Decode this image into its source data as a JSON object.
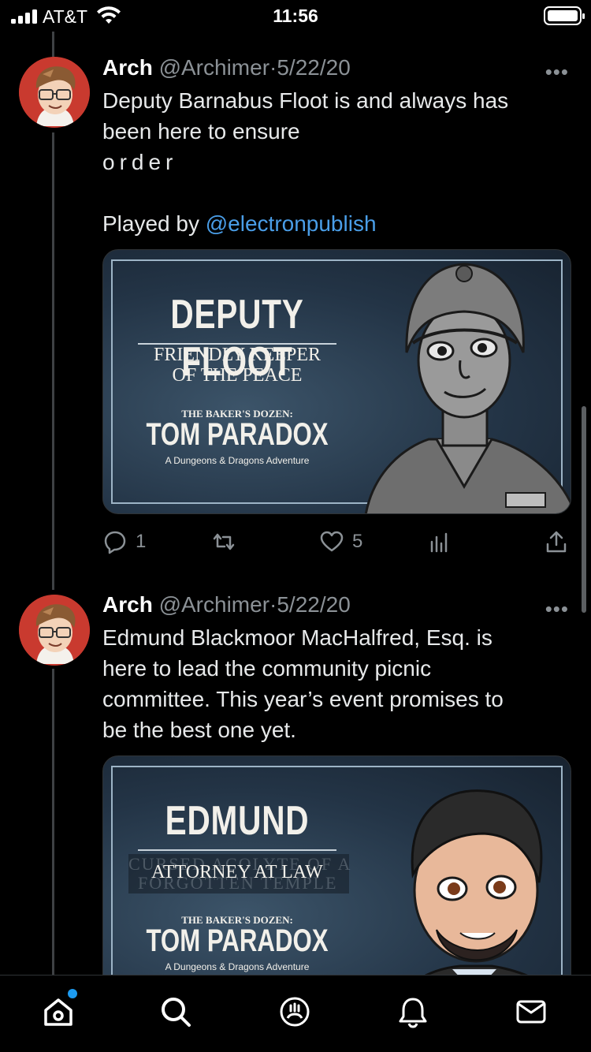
{
  "status_bar": {
    "carrier": "AT&T",
    "time": "11:56"
  },
  "tweets": [
    {
      "name": "Arch",
      "handle": "@Archimer",
      "separator": "·",
      "date": "5/22/20",
      "more": "•••",
      "text_line1": "Deputy Barnabus Floot is and always has",
      "text_line2": "been here to ensure",
      "text_line3": "order",
      "text_played": "Played by ",
      "text_mention": "@electronpublish",
      "card": {
        "title": "DEPUTY FLOOT",
        "subtitle_line1": "FRIENDLY KEEPER",
        "subtitle_line2": "OF THE PEACE",
        "series": "THE BAKER'S DOZEN:",
        "logo": "TOM PARADOX",
        "tagline": "A Dungeons & Dragons Adventure"
      },
      "replies": "1",
      "likes": "5"
    },
    {
      "name": "Arch",
      "handle": "@Archimer",
      "separator": "·",
      "date": "5/22/20",
      "more": "•••",
      "text_line1": "Edmund Blackmoor MacHalfred, Esq. is",
      "text_line2": "here to lead the community picnic",
      "text_line3": "committee. This year’s event promises to",
      "text_line4": "be the best one yet.",
      "card": {
        "title": "EDMUND",
        "subtitle": "ATTORNEY AT LAW",
        "ghost_line1": "CURSED ACOLYTE OF A",
        "ghost_line2": "FORGOTTEN TEMPLE",
        "series": "THE BAKER'S DOZEN:",
        "logo": "TOM PARADOX",
        "tagline": "A Dungeons & Dragons Adventure"
      }
    }
  ],
  "tab_bar": {
    "items": [
      "home-icon",
      "search-icon",
      "spaces-icon",
      "notifications-icon",
      "messages-icon"
    ],
    "accent": "#1d9bf0"
  }
}
